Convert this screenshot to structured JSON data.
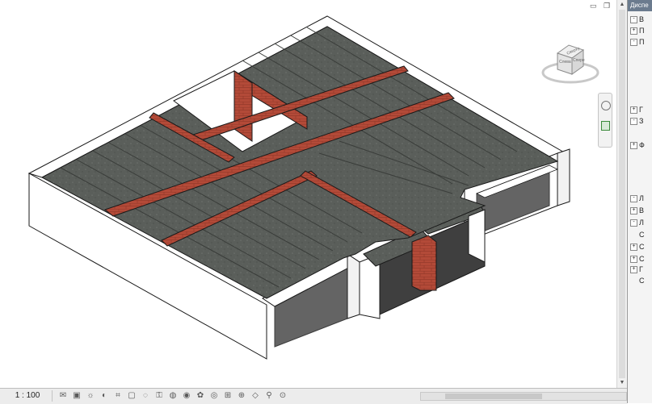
{
  "panel": {
    "title": "Диспе",
    "rows": [
      {
        "box": "-",
        "text": "В"
      },
      {
        "box": "+",
        "text": "П"
      },
      {
        "box": "-",
        "text": "П"
      },
      {
        "box": "+",
        "text": "Г"
      },
      {
        "box": "-",
        "text": "З"
      },
      {
        "box": "+",
        "text": "Ф"
      },
      {
        "box": "-",
        "text": "Л"
      },
      {
        "box": "+",
        "text": "В"
      },
      {
        "box": "-",
        "text": "Л"
      },
      {
        "box": "",
        "text": "С"
      },
      {
        "box": "+",
        "text": "С"
      },
      {
        "box": "+",
        "text": "С"
      },
      {
        "box": "+",
        "text": "Г"
      },
      {
        "box": "",
        "text": "С"
      }
    ]
  },
  "viewcube": {
    "left_face": "Слева",
    "front_face": "Спере",
    "top_label": "Сверху"
  },
  "window_controls": {
    "minimize": "▭",
    "restore": "❐",
    "close": "✕"
  },
  "statusbar": {
    "scale": "1 : 100",
    "icons": [
      "envelope-icon",
      "folder-icon",
      "sun-icon",
      "shadow-icon",
      "crop-icon",
      "crop-region-icon",
      "hide-icon",
      "lock-icon",
      "analytics-icon",
      "reveal-icon",
      "render-icon",
      "temp-hide-icon",
      "constraints-icon",
      "worksharing-icon",
      "design-options-icon",
      "filter-icon",
      "highlight-icon"
    ]
  },
  "colors": {
    "wall": "#ffffff",
    "wall_side": "#f2f2f2",
    "slab": "#5a5e5a",
    "slab_lines": "#3a3d3a",
    "brick": "#b34a38",
    "brick_dark": "#8e3527",
    "outline": "#1a1a1a",
    "shadow": "#4a4a4a"
  }
}
